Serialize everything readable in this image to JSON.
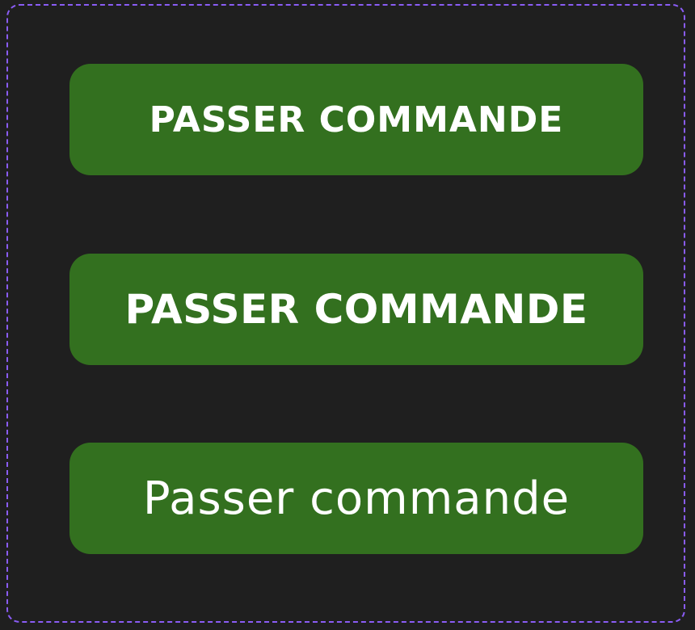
{
  "colors": {
    "background": "#1f1f1f",
    "border_accent": "#8a5cf5",
    "button_fill": "#33701f",
    "button_text": "#ffffff"
  },
  "buttons": [
    {
      "label": "PASSER COMMANDE"
    },
    {
      "label": "PASSER COMMANDE"
    },
    {
      "label": "Passer commande"
    }
  ]
}
